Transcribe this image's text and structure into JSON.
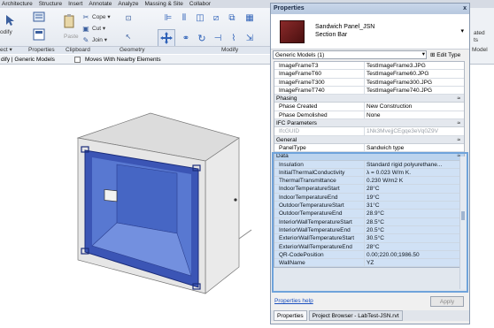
{
  "ribbon": {
    "tabs": [
      "Architecture",
      "Structure",
      "Insert",
      "Annotate",
      "Analyze",
      "Massing & Site",
      "Collabor"
    ],
    "panels": [
      "ect ▾",
      "Properties",
      "Clipboard",
      "Geometry",
      "Modify"
    ],
    "buttons": {
      "modify": "odify",
      "paste": "Paste",
      "cope": "Cope ▾",
      "cut": "Cut ▾",
      "join": "Join ▾"
    },
    "right_fragments": {
      "r1": "ated",
      "r2": "ts",
      "r3": "Model"
    }
  },
  "options_bar": {
    "context": "dify | Generic Models",
    "checkbox_label": "Moves With Nearby Elements"
  },
  "properties": {
    "title": "Properties",
    "close": "x",
    "type_name": "Sandwich Panel_JSN",
    "type_sub": "Section Bar",
    "filter": "Generic Models (1)",
    "edit_type": "Edit Type",
    "rows_top": [
      {
        "k": "ImageFrameT3",
        "v": "TestImageFrame3.JPG"
      },
      {
        "k": "ImageFrameT60",
        "v": "TestImageFrame60.JPG"
      },
      {
        "k": "ImageFrameT300",
        "v": "TestImageFrame300.JPG"
      },
      {
        "k": "ImageFrameT740",
        "v": "TestImageFrame740.JPG"
      }
    ],
    "phasing_group": "Phasing",
    "phasing_rows": [
      {
        "k": "Phase Created",
        "v": "New Construction"
      },
      {
        "k": "Phase Demolished",
        "v": "None"
      }
    ],
    "ifc_group": "IFC Parameters",
    "ifc_rows": [
      {
        "k": "IfcGUID",
        "v": "1Nk3MvejjCEgqe3eVq0Z9V"
      }
    ],
    "general_group": "General",
    "general_rows": [
      {
        "k": "PanelType",
        "v": "Sandwich type"
      }
    ],
    "data_group": "Data",
    "data_rows": [
      {
        "k": "Insulation",
        "v": "Standard rigid polyurethane..."
      },
      {
        "k": "InitialThermalConductivity",
        "v": "λ = 0.023 W/m K."
      },
      {
        "k": "ThermalTransmittance",
        "v": "0.230 W/m2 K"
      },
      {
        "k": "IndoorTemperatureStart",
        "v": "28°C"
      },
      {
        "k": "IndoorTemperatureEnd",
        "v": "19°C"
      },
      {
        "k": "OutdoorTemperatureStart",
        "v": "31°C"
      },
      {
        "k": "OutdoorTemperatureEnd",
        "v": "28.9°C"
      },
      {
        "k": "InteriorWallTemperatureStart",
        "v": "28.5°C"
      },
      {
        "k": "InteriorWallTemperatureEnd",
        "v": "20.5°C"
      },
      {
        "k": "ExteriorWallTemperatureStart",
        "v": "30.5°C"
      },
      {
        "k": "ExteriorWallTemperatureEnd",
        "v": "28°C"
      },
      {
        "k": "QR-CodePosition",
        "v": "0.00;220.00;1986.50"
      },
      {
        "k": "WallName",
        "v": "YZ"
      }
    ],
    "help": "Properties help",
    "apply": "Apply",
    "tabs": [
      "Properties",
      "Project Browser - LabTest-JSN.rvt"
    ]
  },
  "colors": {
    "accent": "#6fa3db",
    "panel_color": "#6b1f1f",
    "glass": "#4c6fd0"
  }
}
